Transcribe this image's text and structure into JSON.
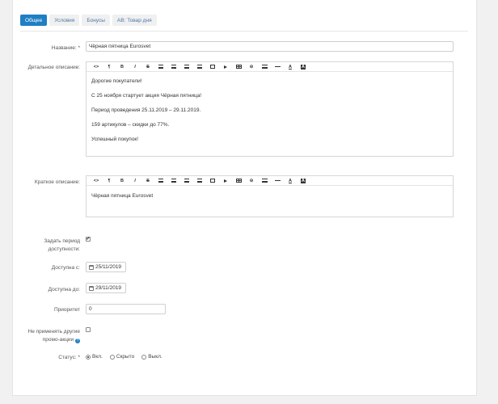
{
  "tabs": [
    {
      "label": "Общее",
      "active": true
    },
    {
      "label": "Условия",
      "active": false
    },
    {
      "label": "Бонусы",
      "active": false
    },
    {
      "label": "AB: Товар дня",
      "active": false
    }
  ],
  "form": {
    "name_label": "Название: *",
    "name_value": "Чёрная пятница Eurosvet",
    "detail_label": "Детальное описание:",
    "detail_paragraphs": [
      "Дорогие покупатели!",
      "С 25 ноября стартует акция Чёрная пятница!",
      "Период проведения 25.11.2019 – 29.11.2019.",
      "159 артикулов – скидки до 77%.",
      "Успешный покупок!"
    ],
    "short_label": "Краткое описание:",
    "short_text": "Чёрная пятница Eurosvet",
    "period_label_1": "Задать период",
    "period_label_2": "доступности:",
    "period_checked": true,
    "from_label": "Доступна с:",
    "from_value": "25/11/2019",
    "to_label": "Доступна до:",
    "to_value": "29/11/2019",
    "priority_label": "Приоритет",
    "priority_value": "0",
    "exclude_label_1": "Не применять другие",
    "exclude_label_2": "промо-акции",
    "exclude_help_icon": "?",
    "exclude_checked": false,
    "status_label": "Статус: *",
    "status_options": [
      "Вкл.",
      "Скрыто",
      "Выкл."
    ],
    "status_selected": "Вкл."
  },
  "toolbar_icons": [
    "code-icon",
    "paragraph-icon",
    "bold-icon",
    "italic-icon",
    "strikethrough-icon",
    "unordered-list-icon",
    "ordered-list-icon",
    "outdent-icon",
    "indent-icon",
    "image-icon",
    "video-icon",
    "table-icon",
    "link-icon",
    "align-icon",
    "horizontal-rule-icon",
    "text-color-icon",
    "background-color-icon"
  ],
  "toolbar_glyphs": {
    "code": "<>",
    "paragraph": "¶",
    "bold": "B",
    "italic": "I",
    "strike": "S",
    "link": "⊝",
    "textcolor": "A",
    "bgcolor": "A"
  }
}
